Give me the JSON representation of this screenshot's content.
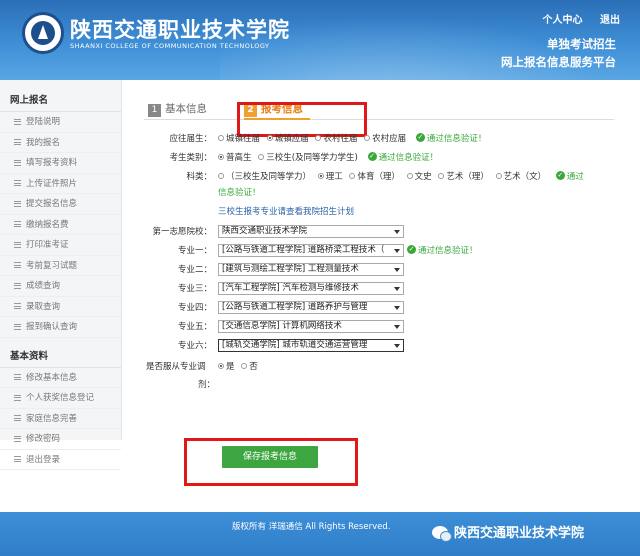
{
  "header": {
    "school_name": "陕西交通职业技术学院",
    "school_name_en": "SHAANXI COLLEGE OF COMMUNICATION TECHNOLOGY",
    "links": [
      "个人中心",
      "退出"
    ],
    "platform_line1": "单独考试招生",
    "platform_line2": "网上报名信息服务平台"
  },
  "sidebar": {
    "section1_title": "网上报名",
    "section1_items": [
      "登陆说明",
      "我的报名",
      "填写报考资料",
      "上传证件照片",
      "提交报名信息",
      "缴纳报名费",
      "打印准考证",
      "考前复习试题",
      "成绩查询",
      "录取查询",
      "报到确认查询"
    ],
    "section2_title": "基本资料",
    "section2_items": [
      "修改基本信息",
      "个人获奖信息登记",
      "家庭信息完善",
      "修改密码",
      "退出登录"
    ]
  },
  "tabs": [
    {
      "num": "1",
      "label": "基本信息"
    },
    {
      "num": "2",
      "label": "报考信息"
    }
  ],
  "form": {
    "graduate_type": {
      "label": "应往届生：",
      "options": [
        "城镇往届",
        "城镇应届",
        "农村往届",
        "农村应届"
      ],
      "selected": "城镇应届",
      "status": "通过信息验证！"
    },
    "candidate_type": {
      "label": "考生类别：",
      "options": [
        "普高生",
        "三校生(及同等学力学生)"
      ],
      "selected": "普高生",
      "status": "通过信息验证！"
    },
    "subject": {
      "label": "科类：",
      "options": [
        "（三校生及同等学力）",
        "理工",
        "体育（理）",
        "文史",
        "艺术（理）",
        "艺术（文）"
      ],
      "selected": "理工",
      "status_part1": "通过",
      "status_part2": "信息验证！"
    },
    "note_link": "三校生报考专业请查看我院招生计划",
    "first_choice": {
      "label": "第一志愿院校：",
      "value": "陕西交通职业技术学院"
    },
    "majors": [
      {
        "label": "专业一：",
        "value": "[公路与铁道工程学院] 道路桥梁工程技术（",
        "status": "通过信息验证！"
      },
      {
        "label": "专业二：",
        "value": "[建筑与测绘工程学院] 工程测量技术"
      },
      {
        "label": "专业三：",
        "value": "[汽车工程学院] 汽车检测与维修技术"
      },
      {
        "label": "专业四：",
        "value": "[公路与铁道工程学院] 道路养护与管理"
      },
      {
        "label": "专业五：",
        "value": "[交通信息学院] 计算机网络技术"
      },
      {
        "label": "专业六：",
        "value": "[城轨交通学院] 城市轨道交通运营管理"
      }
    ],
    "adjust": {
      "label_line1": "是否服从专业调",
      "label_line2": "剂：",
      "options": [
        "是",
        "否"
      ],
      "selected": "是"
    },
    "save_label": "保存报考信息"
  },
  "footer": {
    "copyright": "版权所有 洋瑞通信 All Rights Reserved.",
    "wechat_account": "陕西交通职业技术学院"
  },
  "colors": {
    "brand_blue": "#2f7dc8",
    "accent_orange": "#f0a030",
    "ok_green": "#39a83a",
    "highlight_red": "#e01818"
  }
}
